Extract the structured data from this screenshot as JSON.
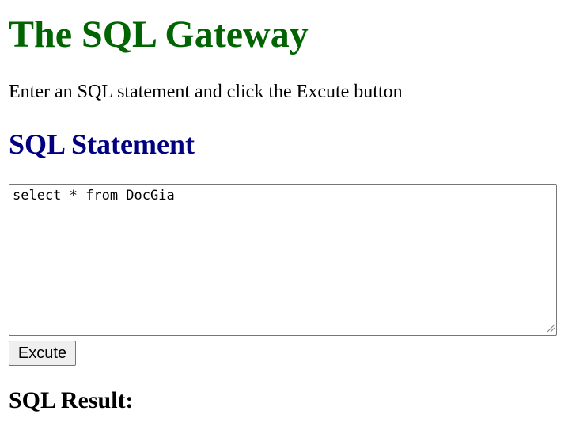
{
  "header": {
    "title": "The SQL Gateway",
    "intro": "Enter an SQL statement and click the Excute button"
  },
  "statement_section": {
    "heading": "SQL Statement",
    "textarea_value": "select * from DocGia",
    "resize_icon": "resize-grip-icon"
  },
  "actions": {
    "execute_label": "Excute"
  },
  "result_section": {
    "heading": "SQL Result:"
  },
  "colors": {
    "title": "#006400",
    "section_heading": "#000080",
    "text": "#000000",
    "textarea_border": "#767676",
    "button_background": "#efefef"
  }
}
